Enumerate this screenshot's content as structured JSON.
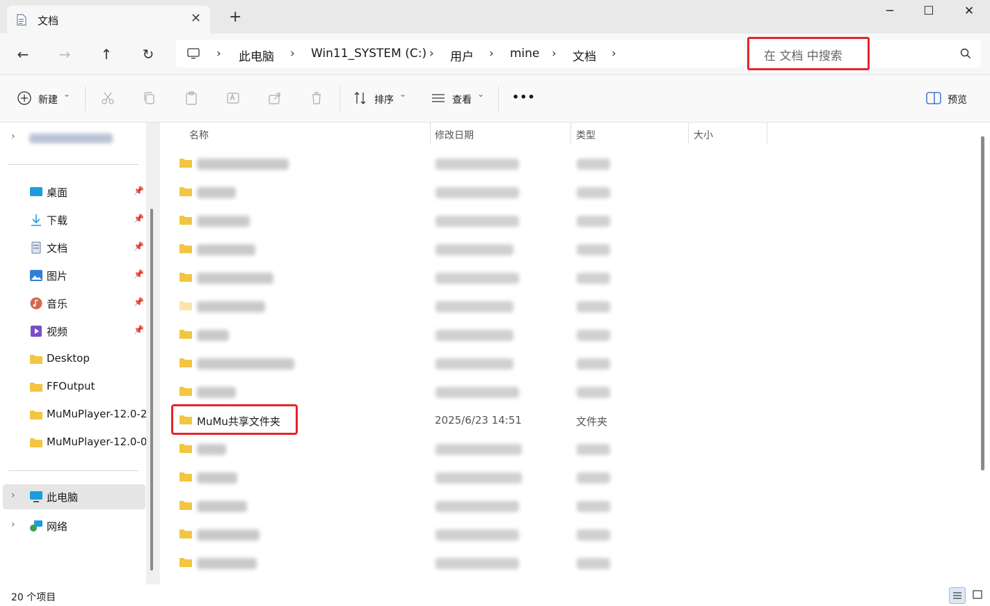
{
  "window": {
    "tab_title": "文档",
    "tab_close": "✕",
    "new_tab": "+",
    "minimize": "─",
    "maximize": "☐",
    "close": "✕"
  },
  "nav": {
    "back": "←",
    "forward": "→",
    "up": "↑",
    "refresh": "↻"
  },
  "breadcrumb": {
    "separator": "›",
    "items": [
      "此电脑",
      "Win11_SYSTEM (C:)",
      "用户",
      "mine",
      "文档"
    ]
  },
  "search": {
    "placeholder": "在 文档 中搜索"
  },
  "toolbar": {
    "new_label": "新建",
    "sort_label": "排序",
    "view_label": "查看",
    "more": "•••",
    "preview_label": "预览",
    "caret": "⌄"
  },
  "sidebar": {
    "pinned": [
      {
        "label": "桌面",
        "icon": "desktop-icon",
        "color": "#1e9be0"
      },
      {
        "label": "下载",
        "icon": "download-icon",
        "color": "#1e9be0"
      },
      {
        "label": "文档",
        "icon": "document-icon",
        "color": "#6b7fa3"
      },
      {
        "label": "图片",
        "icon": "pictures-icon",
        "color": "#2f7fd7"
      },
      {
        "label": "音乐",
        "icon": "music-icon",
        "color": "#d6674c"
      },
      {
        "label": "视频",
        "icon": "video-icon",
        "color": "#7a4fc7"
      }
    ],
    "folders": [
      {
        "label": "Desktop"
      },
      {
        "label": "FFOutput"
      },
      {
        "label": "MuMuPlayer-12.0-2"
      },
      {
        "label": "MuMuPlayer-12.0-0"
      }
    ],
    "this_pc": "此电脑",
    "network": "网络",
    "pin_glyph": "📌",
    "chevron": "›"
  },
  "columns": {
    "name": "名称",
    "modified": "修改日期",
    "type": "类型",
    "size": "大小"
  },
  "highlight_row": {
    "name": "MuMu共享文件夹",
    "modified": "2025/6/23 14:51",
    "type": "文件夹"
  },
  "status": {
    "item_count": "20 个项目"
  },
  "colors": {
    "highlight": "#e5242b",
    "folder": "#f4c542",
    "selected_bg": "#e5e5e5"
  }
}
